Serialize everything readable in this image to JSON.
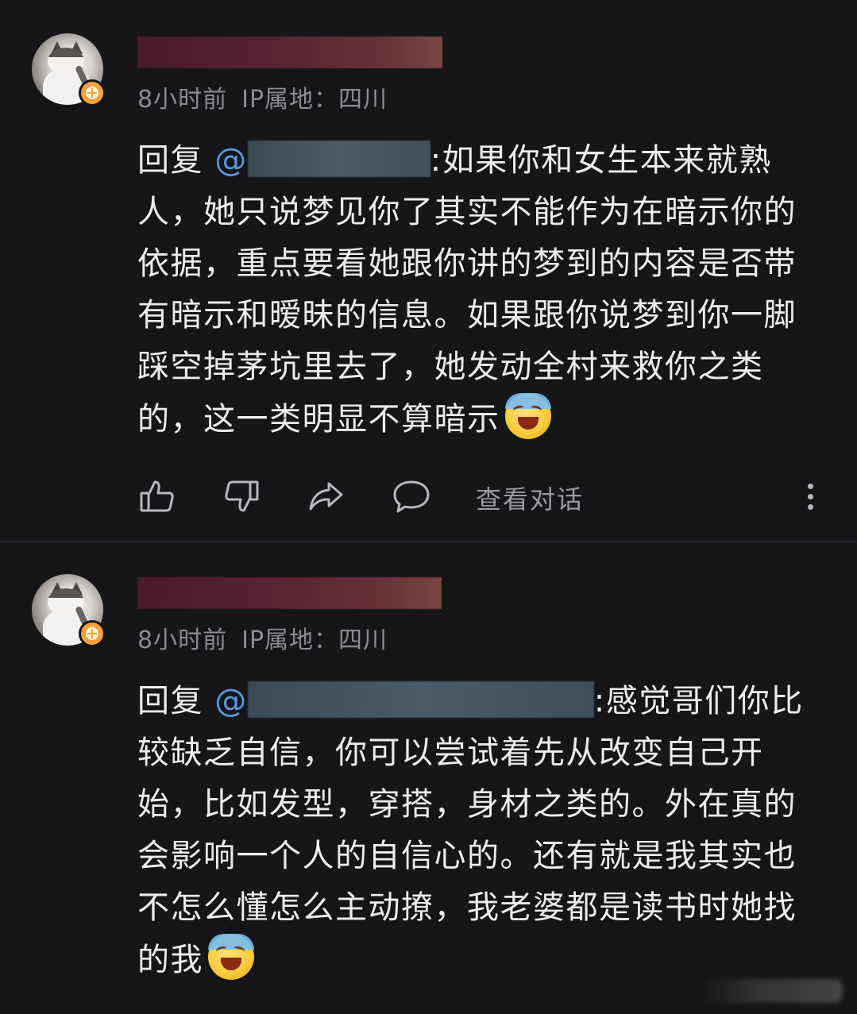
{
  "comments": [
    {
      "time": "8小时前",
      "ip_location": "IP属地：四川",
      "reply_prefix": "回复",
      "mention_at": "@",
      "text": ":如果你和女生本来就熟人，她只说梦见你了其实不能作为在暗示你的依据，重点要看她跟你讲的梦到的内容是否带有暗示和暧昧的信息。如果跟你说梦到你一脚踩空掉茅坑里去了，她发动全村来救你之类的，这一类明显不算暗示",
      "emoji": "laughing-crying-emoji",
      "actions": {
        "like": "thumbs-up-icon",
        "dislike": "thumbs-down-icon",
        "share": "share-arrow-icon",
        "reply": "comment-bubble-icon",
        "view_conversation": "查看对话",
        "more": "more-vertical-icon"
      }
    },
    {
      "time": "8小时前",
      "ip_location": "IP属地：四川",
      "reply_prefix": "回复",
      "mention_at": "@",
      "text": ":感觉哥们你比较缺乏自信，你可以尝试着先从改变自己开始，比如发型，穿搭，身材之类的。外在真的会影响一个人的自信心的。还有就是我其实也不怎么懂怎么主动撩，我老婆都是读书时她找的我",
      "emoji": "laughing-crying-emoji"
    }
  ],
  "colors": {
    "background": "#161618",
    "text": "#ececec",
    "meta": "#8b8b90",
    "mention": "#5b96dd",
    "badge": "#f3a23c"
  }
}
